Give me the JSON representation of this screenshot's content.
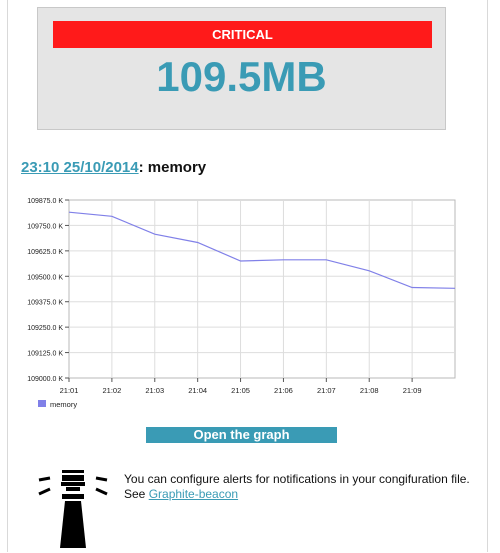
{
  "status": {
    "badge": "CRITICAL",
    "value": "109.5MB",
    "badge_color": "#ff1a1a",
    "value_color": "#3a9bb5"
  },
  "heading": {
    "datetime": "23:10 25/10/2014",
    "separator": ": ",
    "metric": "memory",
    "link_color": "#3a9bb5"
  },
  "chart_data": {
    "type": "line",
    "x": [
      "21:01",
      "21:02",
      "21:03",
      "21:04",
      "21:05",
      "21:06",
      "21:07",
      "21:08",
      "21:09"
    ],
    "series": [
      {
        "name": "memory",
        "color": "#8080e8",
        "values": [
          109815,
          109795,
          109707,
          109666,
          109575,
          109581,
          109581,
          109527,
          109445,
          109441
        ]
      }
    ],
    "y_ticks": [
      "109875.0 K",
      "109750.0 K",
      "109625.0 K",
      "109500.0 K",
      "109375.0 K",
      "109250.0 K",
      "109125.0 K",
      "109000.0 K"
    ],
    "ylim": [
      109000,
      109875
    ],
    "grid": true,
    "legend": "bottom-left"
  },
  "open_button": {
    "label": "Open the graph",
    "color": "#3a9bb5"
  },
  "footer": {
    "icon": "lighthouse-icon",
    "line1": "You can configure alerts for notifications in your congifuration file.",
    "see_prefix": "See ",
    "link": "Graphite-beacon"
  }
}
